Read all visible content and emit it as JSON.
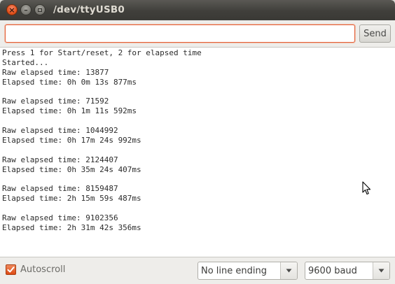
{
  "window": {
    "title": "/dev/ttyUSB0",
    "close_glyph": "×",
    "minimize_glyph": "–"
  },
  "input": {
    "value": "",
    "send_label": "Send"
  },
  "output": {
    "lines": [
      "Press 1 for Start/reset, 2 for elapsed time",
      "Started...",
      "Raw elapsed time: 13877",
      "Elapsed time: 0h 0m 13s 877ms",
      "",
      "Raw elapsed time: 71592",
      "Elapsed time: 0h 1m 11s 592ms",
      "",
      "Raw elapsed time: 1044992",
      "Elapsed time: 0h 17m 24s 992ms",
      "",
      "Raw elapsed time: 2124407",
      "Elapsed time: 0h 35m 24s 407ms",
      "",
      "Raw elapsed time: 8159487",
      "Elapsed time: 2h 15m 59s 487ms",
      "",
      "Raw elapsed time: 9102356",
      "Elapsed time: 2h 31m 42s 356ms"
    ]
  },
  "footer": {
    "autoscroll_label": "Autoscroll",
    "autoscroll_checked": true,
    "line_ending": "No line ending",
    "baud": "9600 baud"
  },
  "colors": {
    "accent": "#dd4a14",
    "titlebar": "#403f3b",
    "output_bg": "#ffffff"
  },
  "icons": {
    "close": "close-icon",
    "minimize": "minimize-icon",
    "maximize": "maximize-icon",
    "checkmark": "checkmark-icon",
    "dropdown": "chevron-down-icon",
    "pointer": "mouse-pointer-icon"
  }
}
